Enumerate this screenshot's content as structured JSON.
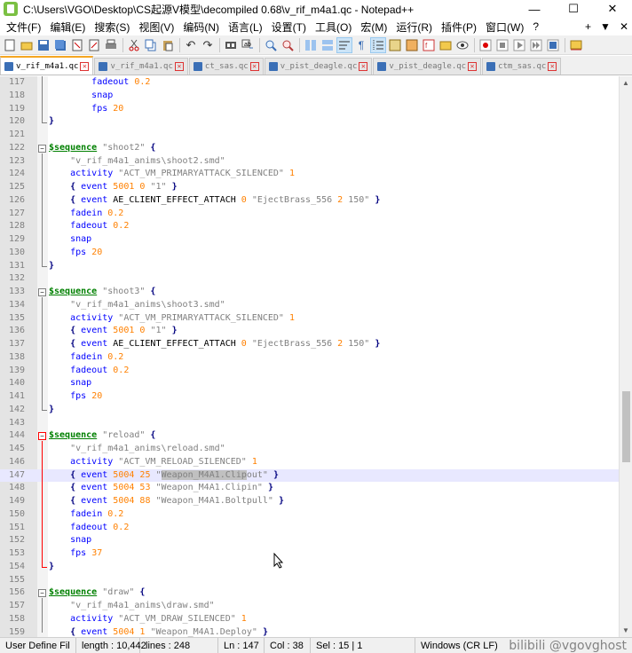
{
  "window": {
    "title": "C:\\Users\\VGO\\Desktop\\CS起源V模型\\decompiled 0.68\\v_rif_m4a1.qc - Notepad++",
    "minimize": "—",
    "maximize": "☐",
    "close": "✕"
  },
  "menu": {
    "items": [
      "文件(F)",
      "编辑(E)",
      "搜索(S)",
      "视图(V)",
      "编码(N)",
      "语言(L)",
      "设置(T)",
      "工具(O)",
      "宏(M)",
      "运行(R)",
      "插件(P)",
      "窗口(W)",
      "?"
    ],
    "right": [
      "+",
      "▼",
      "✕"
    ]
  },
  "toolbar": {
    "icons": [
      "new-file-icon",
      "open-file-icon",
      "save-icon",
      "save-all-icon",
      "close-icon",
      "close-all-icon",
      "print-icon",
      "cut-icon",
      "copy-icon",
      "paste-icon",
      "undo-icon",
      "redo-icon",
      "find-icon",
      "replace-icon",
      "zoom-in-icon",
      "zoom-out-icon",
      "sync-v-icon",
      "sync-h-icon",
      "wrap-icon",
      "all-chars-icon",
      "indent-guide-icon",
      "lang-icon",
      "doc-map-icon",
      "function-list-icon",
      "folder-icon",
      "monitor-icon",
      "record-icon",
      "stop-icon",
      "play-icon",
      "play-multi-icon",
      "save-macro-icon",
      "spell-icon"
    ]
  },
  "tabs": [
    {
      "label": "v_rif_m4a1.qc",
      "active": true
    },
    {
      "label": "v_rif_m4a1.qc",
      "active": false
    },
    {
      "label": "ct_sas.qc",
      "active": false
    },
    {
      "label": "v_pist_deagle.qc",
      "active": false
    },
    {
      "label": "v_pist_deagle.qc",
      "active": false
    },
    {
      "label": "ctm_sas.qc",
      "active": false
    }
  ],
  "editor": {
    "current_line": 147,
    "lines": [
      {
        "n": "117",
        "t": "        fadeout 0.2"
      },
      {
        "n": "118",
        "t": "        snap"
      },
      {
        "n": "119",
        "t": "        fps 20"
      },
      {
        "n": "120",
        "t": "}"
      },
      {
        "n": "121",
        "t": ""
      },
      {
        "n": "122",
        "t": "$sequence \"shoot2\" {"
      },
      {
        "n": "123",
        "t": "    \"v_rif_m4a1_anims\\shoot2.smd\""
      },
      {
        "n": "124",
        "t": "    activity \"ACT_VM_PRIMARYATTACK_SILENCED\" 1"
      },
      {
        "n": "125",
        "t": "    { event 5001 0 \"1\" }"
      },
      {
        "n": "126",
        "t": "    { event AE_CLIENT_EFFECT_ATTACH 0 \"EjectBrass_556 2 150\" }"
      },
      {
        "n": "127",
        "t": "    fadein 0.2"
      },
      {
        "n": "128",
        "t": "    fadeout 0.2"
      },
      {
        "n": "129",
        "t": "    snap"
      },
      {
        "n": "130",
        "t": "    fps 20"
      },
      {
        "n": "131",
        "t": "}"
      },
      {
        "n": "132",
        "t": ""
      },
      {
        "n": "133",
        "t": "$sequence \"shoot3\" {"
      },
      {
        "n": "134",
        "t": "    \"v_rif_m4a1_anims\\shoot3.smd\""
      },
      {
        "n": "135",
        "t": "    activity \"ACT_VM_PRIMARYATTACK_SILENCED\" 1"
      },
      {
        "n": "136",
        "t": "    { event 5001 0 \"1\" }"
      },
      {
        "n": "137",
        "t": "    { event AE_CLIENT_EFFECT_ATTACH 0 \"EjectBrass_556 2 150\" }"
      },
      {
        "n": "138",
        "t": "    fadein 0.2"
      },
      {
        "n": "139",
        "t": "    fadeout 0.2"
      },
      {
        "n": "140",
        "t": "    snap"
      },
      {
        "n": "141",
        "t": "    fps 20"
      },
      {
        "n": "142",
        "t": "}"
      },
      {
        "n": "143",
        "t": ""
      },
      {
        "n": "144",
        "t": "$sequence \"reload\" {"
      },
      {
        "n": "145",
        "t": "    \"v_rif_m4a1_anims\\reload.smd\""
      },
      {
        "n": "146",
        "t": "    activity \"ACT_VM_RELOAD_SILENCED\" 1"
      },
      {
        "n": "147",
        "t": "    { event 5004 25 \"Weapon_M4A1.Clipout\" }"
      },
      {
        "n": "148",
        "t": "    { event 5004 53 \"Weapon_M4A1.Clipin\" }"
      },
      {
        "n": "149",
        "t": "    { event 5004 88 \"Weapon_M4A1.Boltpull\" }"
      },
      {
        "n": "150",
        "t": "    fadein 0.2"
      },
      {
        "n": "151",
        "t": "    fadeout 0.2"
      },
      {
        "n": "152",
        "t": "    snap"
      },
      {
        "n": "153",
        "t": "    fps 37"
      },
      {
        "n": "154",
        "t": "}"
      },
      {
        "n": "155",
        "t": ""
      },
      {
        "n": "156",
        "t": "$sequence \"draw\" {"
      },
      {
        "n": "157",
        "t": "    \"v_rif_m4a1_anims\\draw.smd\""
      },
      {
        "n": "158",
        "t": "    activity \"ACT_VM_DRAW_SILENCED\" 1"
      },
      {
        "n": "159",
        "t": "    { event 5004 1 \"Weapon_M4A1.Deploy\" }"
      }
    ]
  },
  "status": {
    "lang": "User Define Fil",
    "length": "length : 10,442",
    "lines": "lines : 248",
    "ln": "Ln : 147",
    "col": "Col : 38",
    "sel": "Sel : 15 | 1",
    "eol": "Windows (CR LF)",
    "watermark": "bilibili @vgovghost"
  },
  "colors": {
    "keyword": "#0000ff",
    "string": "#808080",
    "number": "#ff8000",
    "sequence": "#008000",
    "fold_active": "#ff0000",
    "current_line_bg": "#e8e8ff"
  }
}
